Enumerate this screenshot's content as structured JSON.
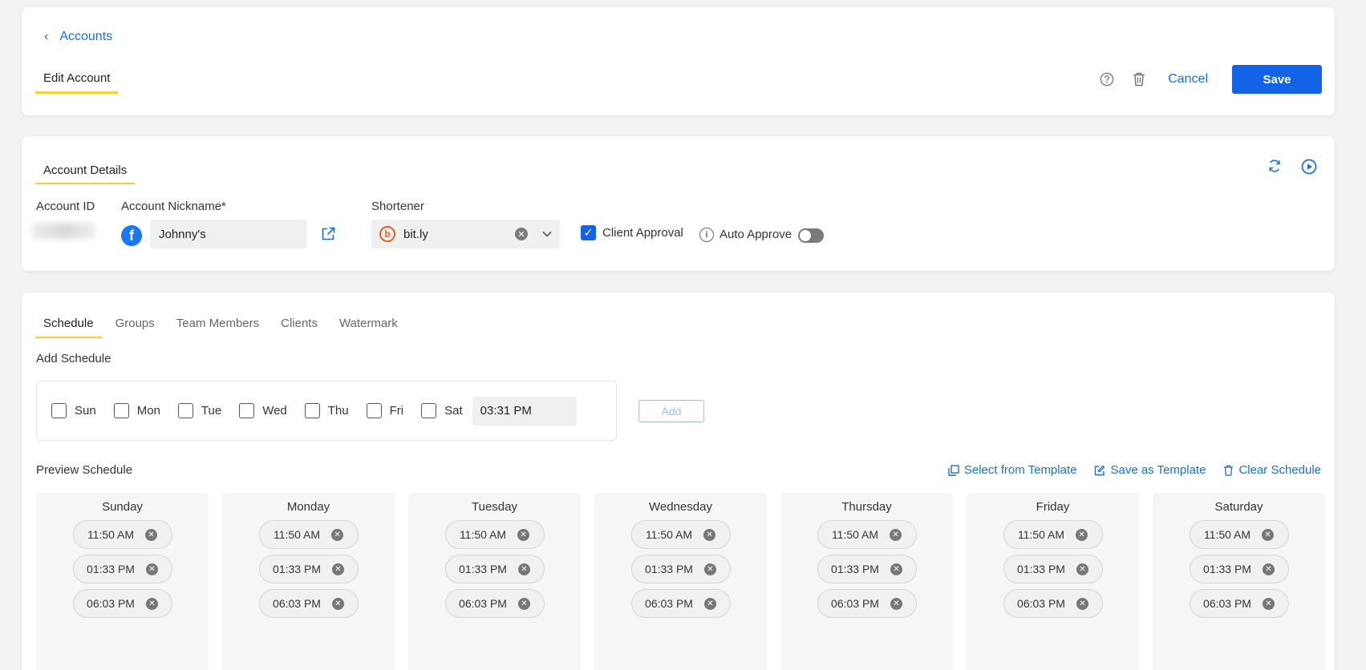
{
  "header": {
    "back_label": "Accounts",
    "tab_label": "Edit Account",
    "cancel_label": "Cancel",
    "save_label": "Save"
  },
  "details": {
    "tab_label": "Account Details",
    "account_id_label": "Account ID",
    "nickname_label": "Account Nickname*",
    "nickname_value": "Johnny's",
    "shortener_label": "Shortener",
    "shortener_value": "bit.ly",
    "client_approval_label": "Client Approval",
    "auto_approve_label": "Auto Approve"
  },
  "schedule": {
    "tabs": [
      {
        "label": "Schedule"
      },
      {
        "label": "Groups"
      },
      {
        "label": "Team Members"
      },
      {
        "label": "Clients"
      },
      {
        "label": "Watermark"
      }
    ],
    "add_label": "Add Schedule",
    "day_checks": [
      "Sun",
      "Mon",
      "Tue",
      "Wed",
      "Thu",
      "Fri",
      "Sat"
    ],
    "time_value": "03:31 PM",
    "add_button": "Add",
    "preview_label": "Preview Schedule",
    "actions": {
      "select_template": "Select from Template",
      "save_template": "Save as Template",
      "clear": "Clear Schedule"
    },
    "days": [
      {
        "name": "Sunday",
        "times": [
          "11:50 AM",
          "01:33 PM",
          "06:03 PM"
        ]
      },
      {
        "name": "Monday",
        "times": [
          "11:50 AM",
          "01:33 PM",
          "06:03 PM"
        ]
      },
      {
        "name": "Tuesday",
        "times": [
          "11:50 AM",
          "01:33 PM",
          "06:03 PM"
        ]
      },
      {
        "name": "Wednesday",
        "times": [
          "11:50 AM",
          "01:33 PM",
          "06:03 PM"
        ]
      },
      {
        "name": "Thursday",
        "times": [
          "11:50 AM",
          "01:33 PM",
          "06:03 PM"
        ]
      },
      {
        "name": "Friday",
        "times": [
          "11:50 AM",
          "01:33 PM",
          "06:03 PM"
        ]
      },
      {
        "name": "Saturday",
        "times": [
          "11:50 AM",
          "01:33 PM",
          "06:03 PM"
        ]
      }
    ]
  }
}
